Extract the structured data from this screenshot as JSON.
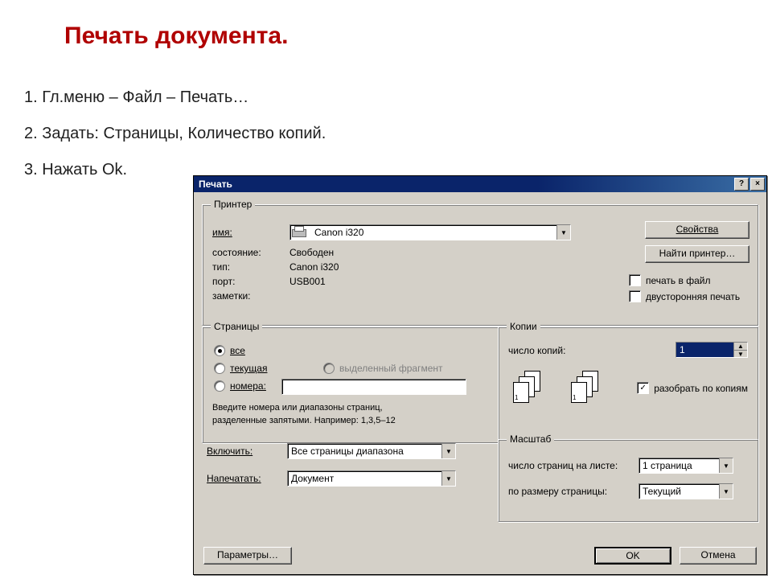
{
  "slide": {
    "title": "Печать документа.",
    "step1": "1. Гл.меню – Файл – Печать…",
    "step2": "2. Задать: Страницы, Количество копий.",
    "step3": "3. Нажать Ok."
  },
  "dialog": {
    "title": "Печать",
    "help_btn": "?",
    "close_btn": "×",
    "printer": {
      "legend": "Принтер",
      "name_label": "имя:",
      "name_value": "Canon i320",
      "status_label": "состояние:",
      "status_value": "Свободен",
      "type_label": "тип:",
      "type_value": "Canon i320",
      "port_label": "порт:",
      "port_value": "USB001",
      "notes_label": "заметки:",
      "properties_btn": "Свойства",
      "find_btn": "Найти принтер…",
      "to_file_chk": "печать в файл",
      "duplex_chk": "двусторонняя печать"
    },
    "pages": {
      "legend": "Страницы",
      "all": "все",
      "current": "текущая",
      "selection": "выделенный фрагмент",
      "numbers_label": "номера:",
      "numbers_value": "",
      "hint1": "Введите номера или диапазоны страниц,",
      "hint2": "разделенные запятыми. Например: 1,3,5–12"
    },
    "copies": {
      "legend": "Копии",
      "count_label": "число копий:",
      "count_value": "1",
      "collate_chk": "разобрать по копиям"
    },
    "include_label": "Включить:",
    "include_value": "Все страницы диапазона",
    "print_what_label": "Напечатать:",
    "print_what_value": "Документ",
    "scale": {
      "legend": "Масштаб",
      "pages_per_sheet_label": "число страниц на листе:",
      "pages_per_sheet_value": "1 страница",
      "fit_label": "по размеру страницы:",
      "fit_value": "Текущий"
    },
    "options_btn": "Параметры…",
    "ok_btn": "OK",
    "cancel_btn": "Отмена"
  }
}
